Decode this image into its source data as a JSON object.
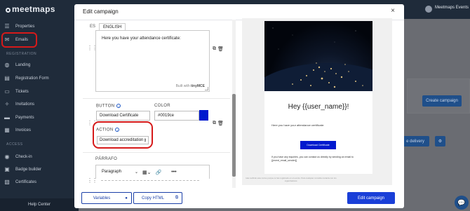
{
  "app": {
    "logo": "meetmaps",
    "user_name": "Meetmaps Events",
    "help_center": "Help Center",
    "sidebar": {
      "items_top": [
        {
          "label": "Properties",
          "icon": "list-icon"
        },
        {
          "label": "Emails",
          "icon": "mail-icon"
        }
      ],
      "section_registration": "REGISTRATION",
      "items_registration": [
        {
          "label": "Landing",
          "icon": "globe-icon"
        },
        {
          "label": "Registration Form",
          "icon": "form-icon"
        },
        {
          "label": "Tickets",
          "icon": "ticket-icon"
        },
        {
          "label": "Invitations",
          "icon": "invite-icon"
        },
        {
          "label": "Payments",
          "icon": "card-icon"
        },
        {
          "label": "Invoices",
          "icon": "invoice-icon"
        }
      ],
      "section_access": "ACCESS",
      "items_access": [
        {
          "label": "Check-in",
          "icon": "check-icon"
        },
        {
          "label": "Badge builder",
          "icon": "badge-icon"
        },
        {
          "label": "Certificates",
          "icon": "certificate-icon"
        }
      ]
    },
    "main": {
      "create_campaign": "Create campaign",
      "e_delivery": "e delivery"
    }
  },
  "modal": {
    "title": "Edit campaign",
    "close": "×",
    "languages": {
      "es": "ES",
      "english": "ENGLISH"
    },
    "text_block": {
      "content": "Here you have your attendance certificate:",
      "built_with": "Built with",
      "tinymce": "tinyMCE"
    },
    "button_field": {
      "label": "BUTTON",
      "value": "Download Certificate"
    },
    "color_field": {
      "label": "COLOR",
      "value": "#0019ce",
      "swatch": "#0019ce"
    },
    "action_field": {
      "label": "ACTION",
      "value": "Download accreditation"
    },
    "paragraph_field": {
      "label": "PÁRRAFO",
      "format": "Paragraph"
    },
    "preview": {
      "heading": "Hey {{user_name}}!",
      "text": "Here you have your attendance certificate:",
      "button": "Download Certificate",
      "footer": "If you have any inquiries, you can contact us directly by sending an email to {{event_email_sender}}",
      "legal": "Has recibido este correo porque te has registrado en el evento. Para cualquier consulta contacta con los organizadores."
    },
    "footer": {
      "variables": "Variables",
      "copy_html": "Copy HTML",
      "edit_campaign": "Edit campaign"
    }
  }
}
